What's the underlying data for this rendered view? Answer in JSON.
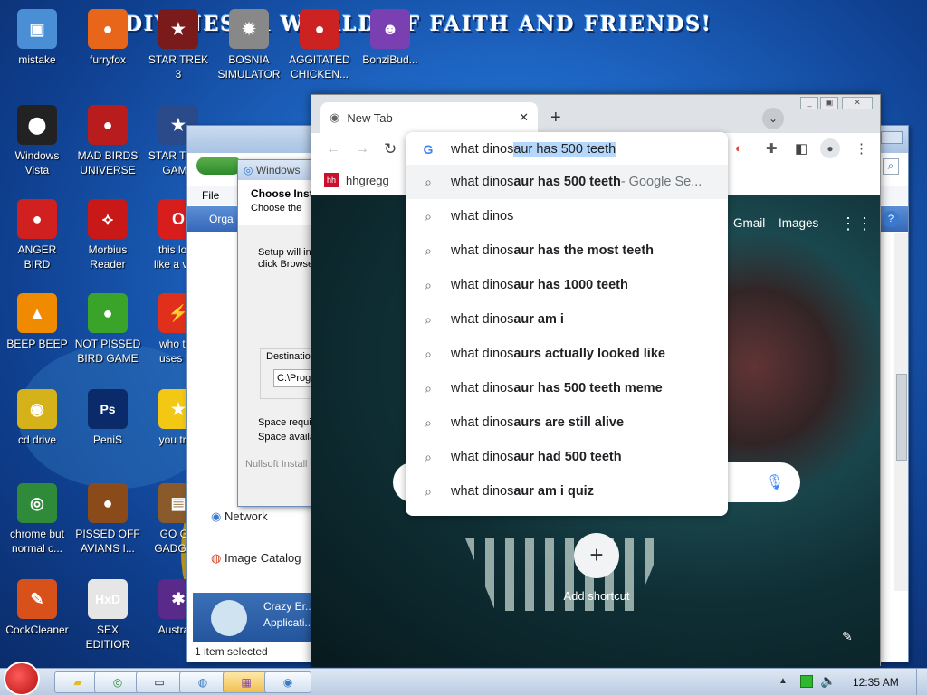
{
  "wallpaper": {
    "title": "DIVINES: A WORLD OF FAITH AND FRIENDS!"
  },
  "desktop_icons": [
    {
      "label": "mistake",
      "color": "#4a8fd6",
      "glyph": "▣"
    },
    {
      "label": "furryfox",
      "color": "#e8661a",
      "glyph": "●"
    },
    {
      "label": "STAR TREK\n3",
      "color": "#7a1a1a",
      "glyph": "★"
    },
    {
      "label": "BOSNIA\nSIMULATOR",
      "color": "#888888",
      "glyph": "✹"
    },
    {
      "label": "AGGITATED\nCHICKEN...",
      "color": "#cc2222",
      "glyph": "●"
    },
    {
      "label": "BonziBud...",
      "color": "#7a3fb0",
      "glyph": "☻"
    },
    {
      "label": "Windows\nVista",
      "color": "#222222",
      "glyph": "⬤"
    },
    {
      "label": "MAD BIRDS\nUNIVERSE",
      "color": "#b81c1c",
      "glyph": "●"
    },
    {
      "label": "STAR TREK\nGAME",
      "color": "#2b4a8a",
      "glyph": "★"
    },
    {
      "label": "ANGER\nBIRD",
      "color": "#d02020",
      "glyph": "●"
    },
    {
      "label": "Morbius\nReader",
      "color": "#c81818",
      "glyph": "⟡"
    },
    {
      "label": "this look\nlike a va...",
      "color": "#d81d1d",
      "glyph": "O"
    },
    {
      "label": "BEEP BEEP",
      "color": "#f08a00",
      "glyph": "▲"
    },
    {
      "label": "NOT PISSED\nBIRD GAME",
      "color": "#3aa42a",
      "glyph": "●"
    },
    {
      "label": "who the\nuses t...",
      "color": "#e0301c",
      "glyph": "⚡"
    },
    {
      "label": "cd drive",
      "color": "#d6b21a",
      "glyph": "◉"
    },
    {
      "label": "PeniS",
      "color": "#0a2a6a",
      "glyph": "Ps"
    },
    {
      "label": "you tri...",
      "color": "#f2c814",
      "glyph": "★"
    },
    {
      "label": "chrome but\nnormal c...",
      "color": "#2f8a3a",
      "glyph": "◎"
    },
    {
      "label": "PISSED OFF\nAVIANS I...",
      "color": "#8a4a1a",
      "glyph": "●"
    },
    {
      "label": "GO GO\nGADGE...",
      "color": "#8a5a2a",
      "glyph": "▤"
    },
    {
      "label": "CockCleaner",
      "color": "#d8501a",
      "glyph": "✎"
    },
    {
      "label": "SEX\nEDITIOR",
      "color": "#e6e6e6",
      "glyph": "HxD"
    },
    {
      "label": "Austra...",
      "color": "#5a2a8a",
      "glyph": "✱"
    }
  ],
  "explorer": {
    "menu_file": "File",
    "organize": "Orga",
    "network": "Network",
    "image_catalog": "Image Catalog",
    "status": "1 item selected",
    "crazy_title": "Crazy Er...",
    "crazy_sub": "Applicati..."
  },
  "installer": {
    "title": "Windows",
    "heading": "Choose Inst",
    "subheading": "Choose the",
    "setup_text": "Setup will in\nclick Browse",
    "dest_label": "Destinatio",
    "dest_value": "C:\\Prog",
    "space_req": "Space requi",
    "space_avail": "Space availa",
    "footer": "Nullsoft Install"
  },
  "browser": {
    "tab_title": "New Tab",
    "bookmark": "hhgregg",
    "gmail": "Gmail",
    "images": "Images",
    "add_shortcut": "Add shortcut",
    "omnibox": {
      "typed": "what dinos",
      "autocomplete": "aur has 500 teeth",
      "suggestions": [
        {
          "plain": "what dinos",
          "bold": "aur has 500 teeth",
          "extra": " - Google Se..."
        },
        {
          "plain": "what dinos",
          "bold": "",
          "extra": ""
        },
        {
          "plain": "what dinos",
          "bold": "aur has the most teeth",
          "extra": ""
        },
        {
          "plain": "what dinos",
          "bold": "aur has 1000 teeth",
          "extra": ""
        },
        {
          "plain": "what dinos",
          "bold": "aur am i",
          "extra": ""
        },
        {
          "plain": "what dinos",
          "bold": "aurs actually looked like",
          "extra": ""
        },
        {
          "plain": "what dinos",
          "bold": "aur has 500 teeth meme",
          "extra": ""
        },
        {
          "plain": "what dinos",
          "bold": "aurs are still alive",
          "extra": ""
        },
        {
          "plain": "what dinos",
          "bold": "aur had 500 teeth",
          "extra": ""
        },
        {
          "plain": "what dinos",
          "bold": "aur am i quiz",
          "extra": ""
        }
      ]
    }
  },
  "taskbar": {
    "clock": "12:35 AM"
  }
}
